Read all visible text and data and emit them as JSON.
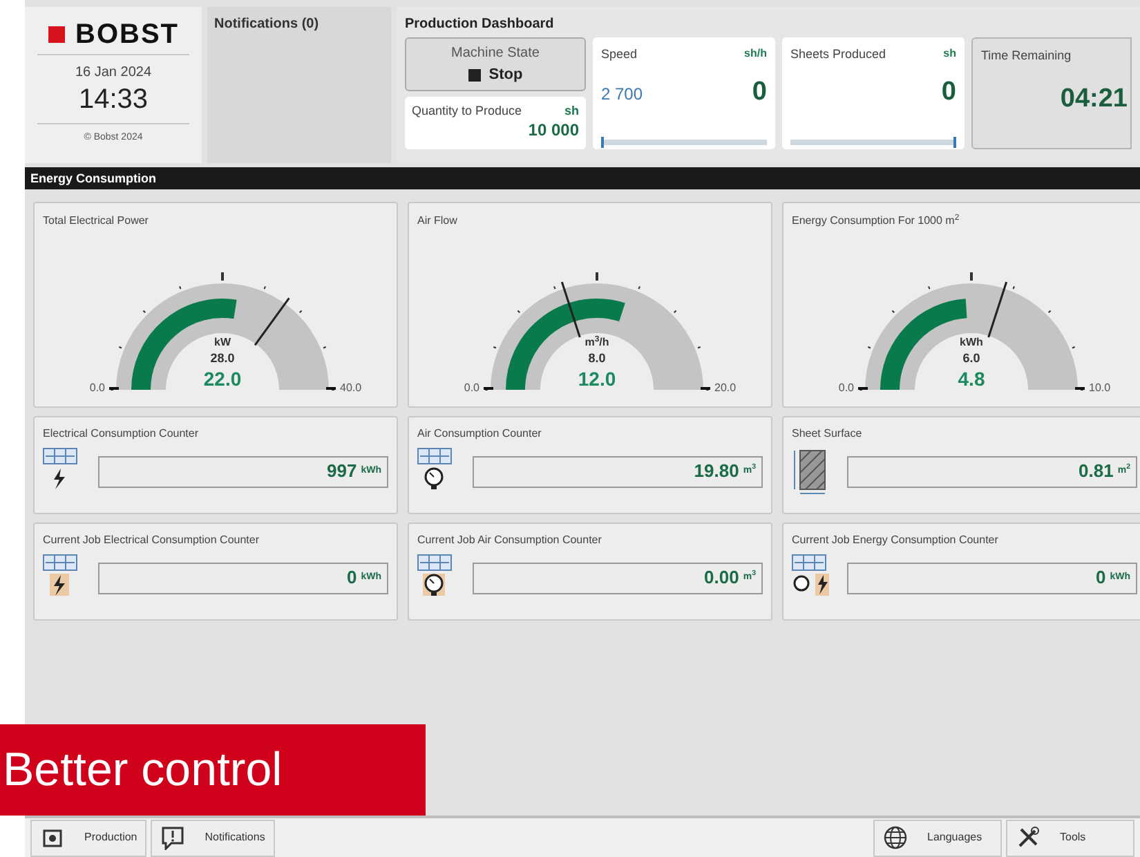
{
  "brand": {
    "logo": "BOBST",
    "date": "16 Jan 2024",
    "time": "14:33",
    "copyright": "© Bobst 2024"
  },
  "notifications": {
    "title": "Notifications (0)"
  },
  "production_dashboard": {
    "title": "Production Dashboard",
    "machine_state": {
      "label": "Machine State",
      "value": "Stop"
    },
    "quantity": {
      "label": "Quantity to Produce",
      "unit": "sh",
      "value": "10 000"
    },
    "tiles": [
      {
        "kind": "meter",
        "label": "Speed",
        "unit": "sh/h",
        "target": "2 700",
        "value": "0",
        "level": 0
      },
      {
        "kind": "meter",
        "label": "Sheets Produced",
        "unit": "sh",
        "value": "0",
        "level": 1
      },
      {
        "kind": "time",
        "label": "Time Remaining",
        "value": "04:21"
      }
    ]
  },
  "section": {
    "title": "Energy Consumption"
  },
  "gauges": [
    {
      "title": "Total Electrical Power",
      "unit": "kW",
      "setpoint": "28.0",
      "value": "22.0",
      "min": "0.0",
      "max": "40.0",
      "level": 0.55
    },
    {
      "title": "Air Flow",
      "unit": "m$^{3}$/h",
      "setpoint": "8.0",
      "value": "12.0",
      "min": "0.0",
      "max": "20.0",
      "level": 0.6
    },
    {
      "title": "Energy Consumption For 1000 m$^{2}$",
      "unit": "kWh",
      "setpoint": "6.0",
      "value": "4.8",
      "min": "0.0",
      "max": "10.0",
      "level": 0.48
    }
  ],
  "counters": [
    {
      "title": "Electrical Consumption Counter",
      "kind": "power",
      "job": false,
      "value": "997",
      "unit": "kWh"
    },
    {
      "title": "Air Consumption Counter",
      "kind": "air",
      "job": false,
      "value": "19.80",
      "unit": "m$^{3}$"
    },
    {
      "title": "Sheet Surface",
      "kind": "surface",
      "job": false,
      "value": "0.81",
      "unit": "m$^{2}$"
    },
    {
      "title": "Current Job Electrical Consumption Counter",
      "kind": "power",
      "job": true,
      "value": "0",
      "unit": "kWh"
    },
    {
      "title": "Current Job Air Consumption Counter",
      "kind": "air",
      "job": true,
      "value": "0.00",
      "unit": "m$^{3}$"
    },
    {
      "title": "Current Job Energy Consumption Counter",
      "kind": "both",
      "job": true,
      "value": "0",
      "unit": "kWh"
    }
  ],
  "bottom_bar": {
    "left": [
      {
        "label": "Production",
        "kind": "production"
      },
      {
        "label": "Notifications",
        "kind": "notifications"
      }
    ],
    "right": [
      {
        "label": "Languages",
        "kind": "globe"
      },
      {
        "label": "Tools",
        "kind": "tools"
      }
    ]
  },
  "banner": {
    "text": "Better control"
  }
}
